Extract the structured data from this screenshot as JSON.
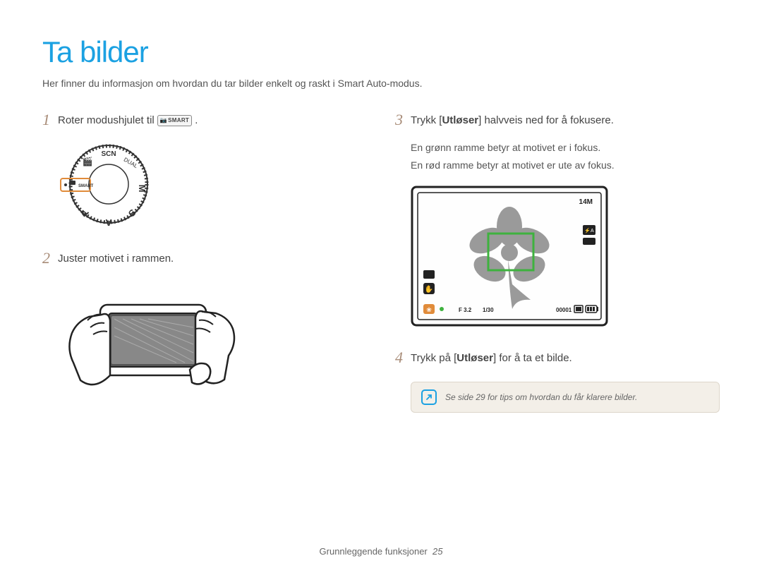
{
  "title": "Ta bilder",
  "subtitle": "Her finner du informasjon om hvordan du tar bilder enkelt og raskt i Smart Auto-modus.",
  "steps": {
    "s1": {
      "num": "1",
      "prefix": "Roter modushjulet til ",
      "suffix": "."
    },
    "s2": {
      "num": "2",
      "text": "Juster motivet i rammen."
    },
    "s3": {
      "num": "3",
      "prefix": "Trykk [",
      "bold": "Utløser",
      "suffix": "] halvveis ned for å fokusere.",
      "sub1": "En grønn ramme betyr at motivet er i fokus.",
      "sub2": "En rød ramme betyr at motivet er ute av fokus."
    },
    "s4": {
      "num": "4",
      "prefix": "Trykk på [",
      "bold": "Utløser",
      "suffix": "] for å ta et bilde."
    }
  },
  "smart_badge": "SMART",
  "note": "Se side 29 for tips om hvordan du får klarere bilder.",
  "footer": {
    "section": "Grunnleggende funksjoner",
    "page": "25"
  },
  "screen": {
    "res": "14M",
    "fstop": "F 3.2",
    "shutter": "1/30",
    "count": "00001"
  },
  "colors": {
    "title": "#1ba1e2",
    "stepnum": "#a88c78",
    "focusbox": "#3eb23e"
  }
}
